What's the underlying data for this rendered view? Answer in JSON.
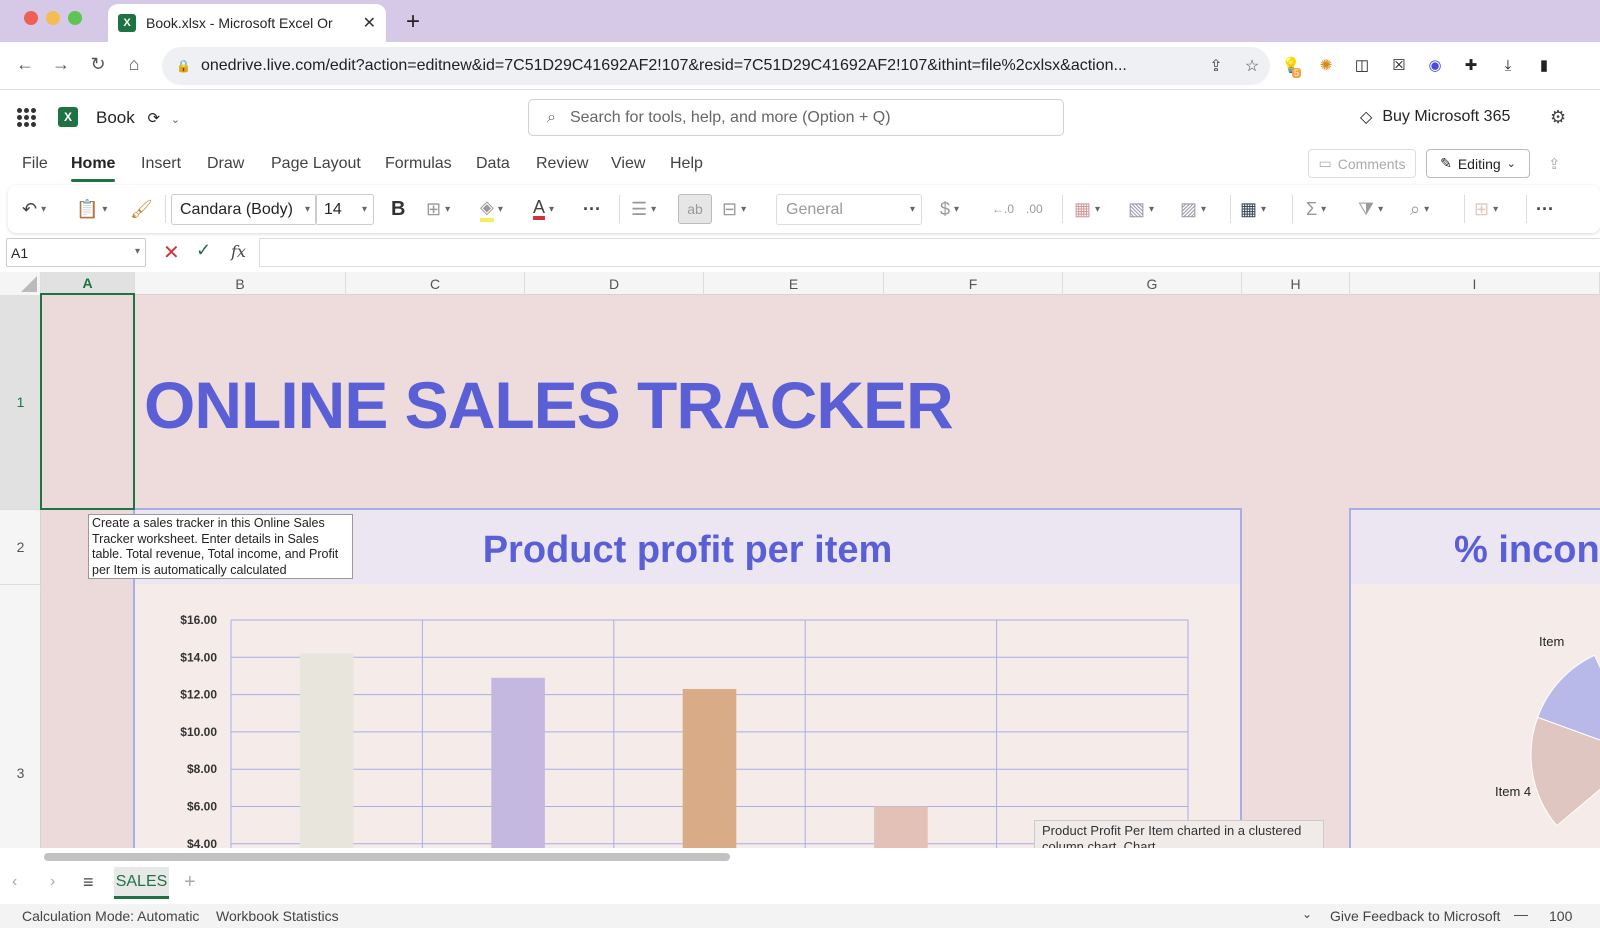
{
  "browser": {
    "tab_title": "Book.xlsx - Microsoft Excel Or",
    "tab_close": "✕",
    "new_tab": "+",
    "url": "onedrive.live.com/edit?action=editnew&id=7C51D29C41692AF2!107&resid=7C51D29C41692AF2!107&ithint=file%2cxlsx&action...",
    "ext_badge": "5"
  },
  "app": {
    "logo_letter": "X",
    "book_name": "Book",
    "search_placeholder": "Search for tools, help, and more (Option + Q)",
    "buy_label": "Buy Microsoft 365"
  },
  "menu": {
    "items": [
      "File",
      "Home",
      "Insert",
      "Draw",
      "Page Layout",
      "Formulas",
      "Data",
      "Review",
      "View",
      "Help"
    ],
    "comments_label": "Comments",
    "editing_label": "Editing"
  },
  "ribbon": {
    "font_name": "Candara (Body)",
    "font_size": "14",
    "number_format": "General",
    "bold_label": "B",
    "font_color_label": "A",
    "currency_label": "$"
  },
  "formula_bar": {
    "name_box": "A1",
    "fx_label": "fx",
    "content": ""
  },
  "sheet": {
    "columns": [
      "A",
      "B",
      "C",
      "D",
      "E",
      "F",
      "G",
      "H",
      "I"
    ],
    "rows": [
      "1",
      "2",
      "3"
    ],
    "title": "ONLINE SALES TRACKER",
    "note": "Create a sales tracker in this Online Sales Tracker worksheet. Enter details in Sales table. Total revenue, Total income, and Profit per Item is automatically calculated",
    "tooltip": "Product Profit Per Item charted in a clustered column chart. Chart"
  },
  "chart_data": [
    {
      "type": "bar",
      "title": "Product profit per item",
      "y_tick_labels": [
        "$16.00",
        "$14.00",
        "$12.00",
        "$10.00",
        "$8.00",
        "$6.00",
        "$4.00"
      ],
      "values": [
        14.2,
        12.9,
        12.3,
        6.0
      ],
      "colors": [
        "#e8e5dc",
        "#c4b8e0",
        "#d9ab86",
        "#e3c1b6"
      ],
      "ylim": [
        4,
        16
      ],
      "grid": true
    },
    {
      "type": "pie",
      "title": "% incon",
      "labels": [
        "Item",
        "Item 4"
      ],
      "colors": [
        "#b8b9e8",
        "#e0c6c0"
      ]
    }
  ],
  "sheet_tabs": {
    "active": "SALES",
    "add": "+"
  },
  "status": {
    "calc_mode": "Calculation Mode: Automatic",
    "stats": "Workbook Statistics",
    "feedback": "Give Feedback to Microsoft",
    "zoom": "100"
  }
}
